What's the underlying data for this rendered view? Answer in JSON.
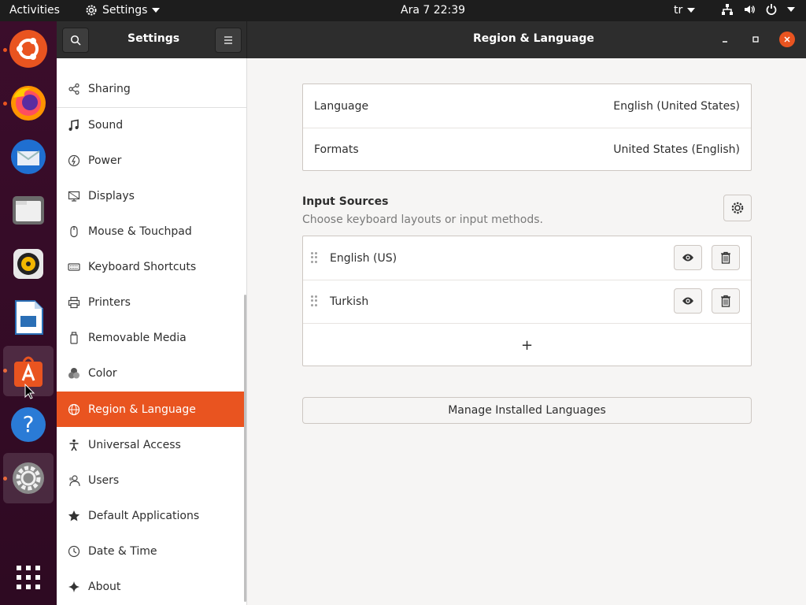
{
  "topbar": {
    "activities": "Activities",
    "app_menu": "Settings",
    "clock": "Ara 7  22:39",
    "input_indicator": "tr"
  },
  "dock": {
    "apps": [
      "ubuntu-logo-icon",
      "firefox-icon",
      "thunderbird-icon",
      "files-icon",
      "rhythmbox-icon",
      "libreoffice-writer-icon",
      "software-center-icon",
      "help-icon",
      "settings-icon",
      "show-applications-icon"
    ]
  },
  "window": {
    "sidebar_title": "Settings",
    "page_title": "Region & Language"
  },
  "sidebar": {
    "items": [
      {
        "label": "Sharing",
        "icon": "share-icon"
      },
      {
        "label": "Sound",
        "icon": "music-note-icon"
      },
      {
        "label": "Power",
        "icon": "power-icon"
      },
      {
        "label": "Displays",
        "icon": "display-icon"
      },
      {
        "label": "Mouse & Touchpad",
        "icon": "mouse-icon"
      },
      {
        "label": "Keyboard Shortcuts",
        "icon": "keyboard-icon"
      },
      {
        "label": "Printers",
        "icon": "printer-icon"
      },
      {
        "label": "Removable Media",
        "icon": "removable-media-icon"
      },
      {
        "label": "Color",
        "icon": "color-icon"
      },
      {
        "label": "Region & Language",
        "icon": "globe-icon",
        "selected": true
      },
      {
        "label": "Universal Access",
        "icon": "accessibility-icon"
      },
      {
        "label": "Users",
        "icon": "users-icon"
      },
      {
        "label": "Default Applications",
        "icon": "star-icon"
      },
      {
        "label": "Date & Time",
        "icon": "clock-icon"
      },
      {
        "label": "About",
        "icon": "about-sparkle-icon"
      }
    ]
  },
  "region": {
    "language_label": "Language",
    "language_value": "English (United States)",
    "formats_label": "Formats",
    "formats_value": "United States (English)"
  },
  "input_sources": {
    "title": "Input Sources",
    "subtitle": "Choose keyboard layouts or input methods.",
    "sources": [
      "English (US)",
      "Turkish"
    ],
    "add_label": "+",
    "manage_label": "Manage Installed Languages"
  },
  "colors": {
    "accent": "#e95420",
    "topbar": "#1d1d1d",
    "headerbar": "#2d2d2d"
  }
}
